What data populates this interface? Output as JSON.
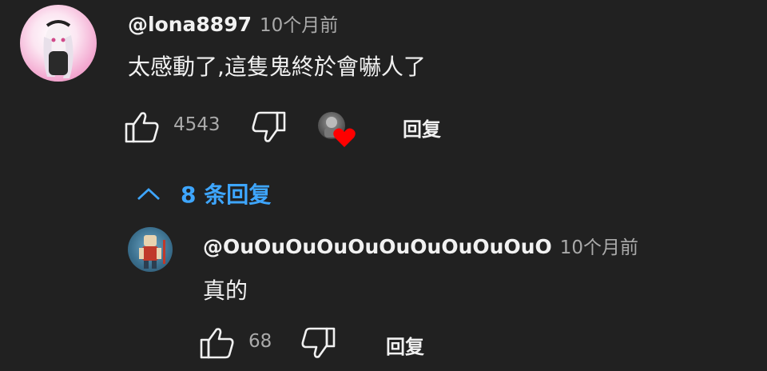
{
  "comment": {
    "handle": "@lona8897",
    "time": "10个月前",
    "text": "太感動了,這隻鬼終於會嚇人了",
    "likes": "4543",
    "reply_label": "回复"
  },
  "replies_toggle": {
    "label": "8 条回复"
  },
  "reply": {
    "handle": "@OuOuOuOuOuOuOuOuOuOuO",
    "time": "10个月前",
    "text": "真的",
    "likes": "68",
    "reply_label": "回复"
  },
  "colors": {
    "background": "#212121",
    "accent": "#3ea6ff",
    "heart": "#ff0000"
  }
}
